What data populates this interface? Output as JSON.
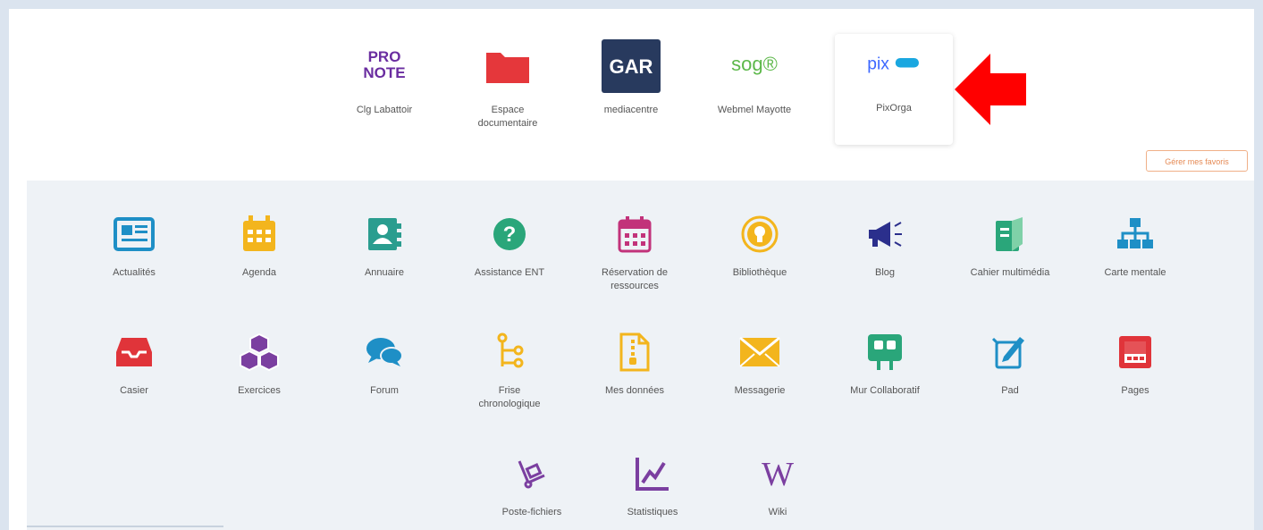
{
  "favorites": {
    "items": [
      {
        "name": "pronote",
        "label": "Clg Labattoir",
        "logo_text": "PRO\nNOTE"
      },
      {
        "name": "espace-documentaire",
        "label": "Espace documentaire"
      },
      {
        "name": "gar",
        "label": "mediacentre",
        "logo_text": "GAR"
      },
      {
        "name": "webmail",
        "label": "Webmel Mayotte",
        "logo_text": "sog®"
      },
      {
        "name": "pixorga",
        "label": "PixOrga",
        "logo_text": "pix"
      }
    ],
    "manage_label": "Gérer mes favoris"
  },
  "apps": {
    "items": [
      {
        "label": "Actualités",
        "icon": "newspaper-icon",
        "color": "#1e8fc6"
      },
      {
        "label": "Agenda",
        "icon": "calendar-icon",
        "color": "#f3b51d"
      },
      {
        "label": "Annuaire",
        "icon": "address-book-icon",
        "color": "#2a9d8f"
      },
      {
        "label": "Assistance ENT",
        "icon": "help-icon",
        "color": "#2aa67a"
      },
      {
        "label": "Réservation de ressources",
        "icon": "booking-calendar-icon",
        "color": "#c2327a"
      },
      {
        "label": "Bibliothèque",
        "icon": "lightbulb-icon",
        "color": "#f3b51d"
      },
      {
        "label": "Blog",
        "icon": "megaphone-icon",
        "color": "#2b2f8c"
      },
      {
        "label": "Cahier multimédia",
        "icon": "notebook-icon",
        "color": "#2aa67a"
      },
      {
        "label": "Carte mentale",
        "icon": "sitemap-icon",
        "color": "#1e8fc6"
      },
      {
        "label": "Casier",
        "icon": "inbox-icon",
        "color": "#e0343a"
      },
      {
        "label": "Exercices",
        "icon": "cubes-icon",
        "color": "#7b3fa0"
      },
      {
        "label": "Forum",
        "icon": "chat-icon",
        "color": "#1e8fc6"
      },
      {
        "label": "Frise chronologique",
        "icon": "timeline-icon",
        "color": "#f3b51d"
      },
      {
        "label": "Mes données",
        "icon": "zip-file-icon",
        "color": "#f3b51d"
      },
      {
        "label": "Messagerie",
        "icon": "envelope-icon",
        "color": "#f3b51d"
      },
      {
        "label": "Mur Collaboratif",
        "icon": "board-icon",
        "color": "#2aa67a"
      },
      {
        "label": "Pad",
        "icon": "pad-icon",
        "color": "#1e8fc6"
      },
      {
        "label": "Pages",
        "icon": "window-icon",
        "color": "#e0343a"
      },
      {
        "label": "Poste-fichiers",
        "icon": "hand-truck-icon",
        "color": "#7b3fa0"
      },
      {
        "label": "Statistiques",
        "icon": "chart-line-icon",
        "color": "#7b3fa0"
      },
      {
        "label": "Wiki",
        "icon": "wiki-icon",
        "color": "#7b3fa0",
        "glyph": "W"
      }
    ]
  },
  "annotation": {
    "icon": "red-arrow-icon",
    "color": "#ff0000"
  }
}
